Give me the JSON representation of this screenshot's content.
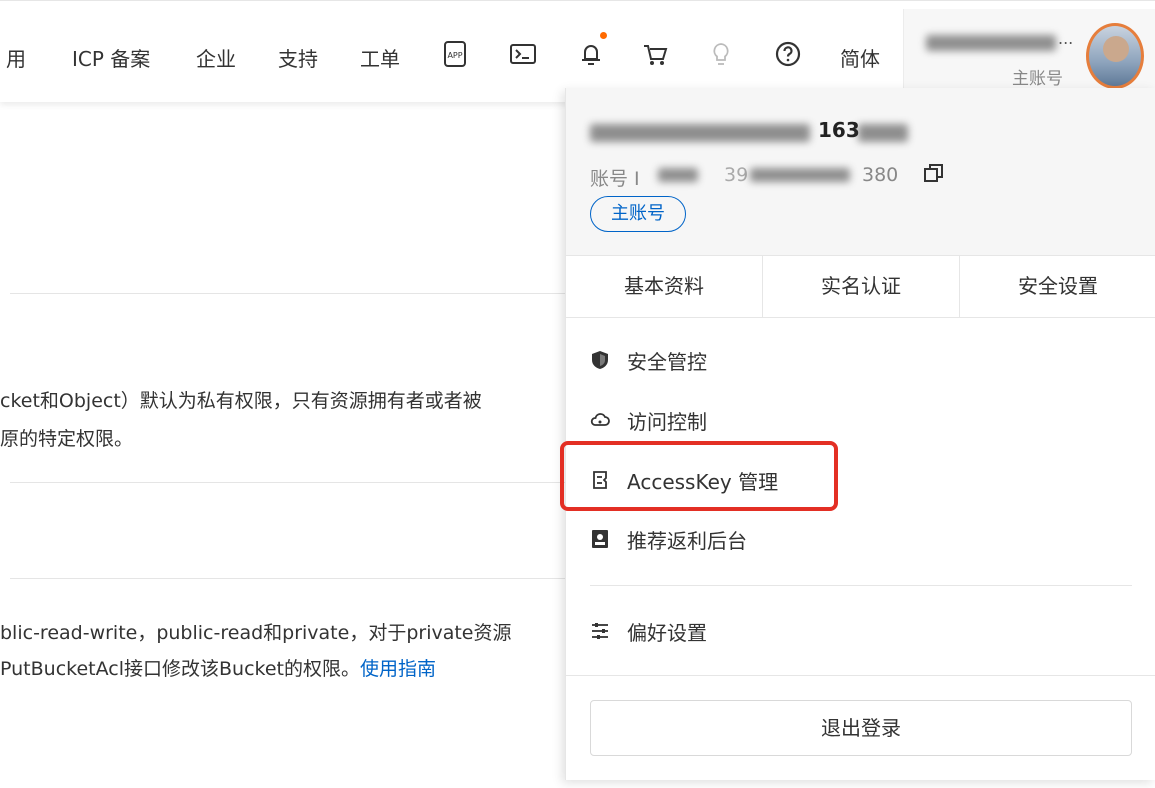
{
  "nav": {
    "items": [
      "用",
      "ICP 备案",
      "企业",
      "支持",
      "工单",
      "简体"
    ],
    "icons": [
      "app-icon",
      "terminal-icon",
      "bell-icon",
      "cart-icon",
      "lightbulb-icon",
      "help-icon"
    ],
    "notification_dot_color": "#ff6a00"
  },
  "account": {
    "name_masked": "...",
    "role": "主账号"
  },
  "content": {
    "para1_line1": "cket和Object）默认为私有权限，只有资源拥有者或者被",
    "para1_line2": "原的特定权限。",
    "para2_line1": "blic-read-write，public-read和private，对于private资源",
    "para2_line2_prefix": "PutBucketAcl接口修改该Bucket的权限。",
    "para2_link": "使用指南"
  },
  "dropdown": {
    "account_name_visible": "163",
    "account_id_prefix": "账号 I",
    "account_id_mid": "39",
    "account_id_suffix": "380",
    "role_badge": "主账号",
    "tabs": [
      "基本资料",
      "实名认证",
      "安全设置"
    ],
    "menu": [
      {
        "icon": "shield-icon",
        "label": "安全管控"
      },
      {
        "icon": "cloud-icon",
        "label": "访问控制"
      },
      {
        "icon": "key-icon",
        "label": "AccessKey 管理",
        "highlighted": true
      },
      {
        "icon": "portrait-icon",
        "label": "推荐返利后台"
      },
      {
        "icon": "sliders-icon",
        "label": "偏好设置"
      }
    ],
    "logout": "退出登录"
  },
  "colors": {
    "accent": "#0064c8",
    "highlight": "#e32f24"
  }
}
